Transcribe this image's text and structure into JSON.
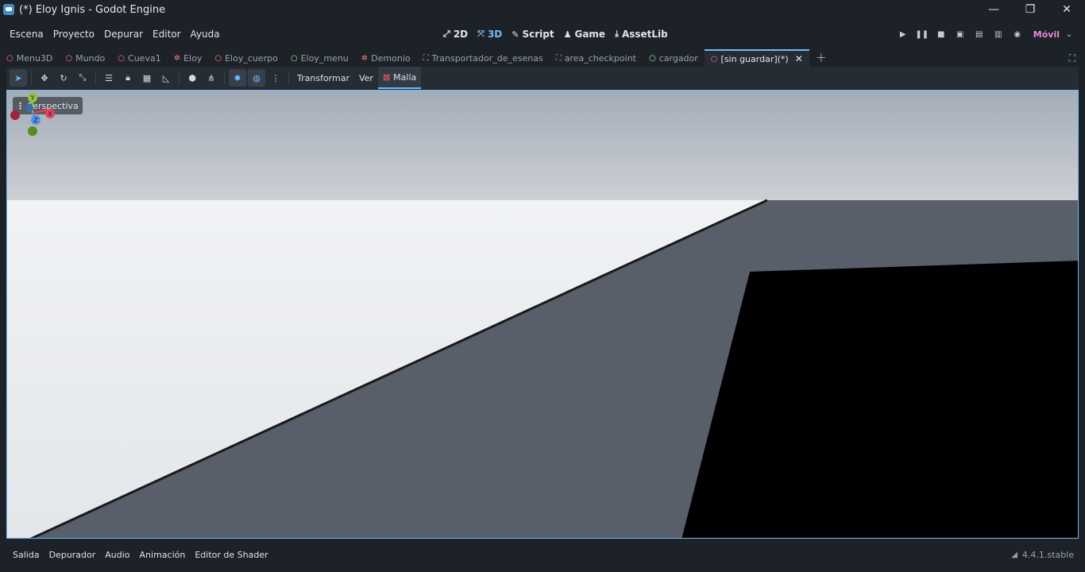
{
  "window": {
    "title": "(*) Eloy Ignis - Godot Engine",
    "controls": {
      "minimize": "—",
      "maximize": "❐",
      "close": "✕"
    }
  },
  "menu": [
    "Escena",
    "Proyecto",
    "Depurar",
    "Editor",
    "Ayuda"
  ],
  "workspaces": [
    {
      "label": "2D",
      "icon": "2d-icon"
    },
    {
      "label": "3D",
      "icon": "3d-icon",
      "active": true
    },
    {
      "label": "Script",
      "icon": "script-icon"
    },
    {
      "label": "Game",
      "icon": "game-icon"
    },
    {
      "label": "AssetLib",
      "icon": "assetlib-icon"
    }
  ],
  "run_bar": {
    "renderer": "Móvil"
  },
  "scene_tabs": [
    {
      "label": "Menu3D",
      "icon": "node3d-icon",
      "color": "#ff7b7b"
    },
    {
      "label": "Mundo",
      "icon": "node3d-icon",
      "color": "#ff7b7b"
    },
    {
      "label": "Cueva1",
      "icon": "node3d-icon",
      "color": "#ff7b7b"
    },
    {
      "label": "Eloy",
      "icon": "character-icon",
      "color": "#ff7b7b"
    },
    {
      "label": "Eloy_cuerpo",
      "icon": "node3d-icon",
      "color": "#ff7b7b"
    },
    {
      "label": "Eloy_menu",
      "icon": "control-icon",
      "color": "#8eef97"
    },
    {
      "label": "Demonio",
      "icon": "character-icon",
      "color": "#ff7b7b"
    },
    {
      "label": "Transportador_de_esenas",
      "icon": "area-icon",
      "color": "#ff7b7b"
    },
    {
      "label": "area_checkpoint",
      "icon": "area-icon",
      "color": "#ff7b7b"
    },
    {
      "label": "cargador",
      "icon": "control-icon",
      "color": "#8eef97"
    },
    {
      "label": "[sin guardar](*)",
      "icon": "node3d-icon",
      "color": "#ff7b7b",
      "active": true
    }
  ],
  "toolbar": {
    "transform_menu": "Transformar",
    "view_menu": "Ver",
    "mesh_menu": "Malla"
  },
  "viewport": {
    "perspective_label": "Perspectiva",
    "gizmo": {
      "x": "X",
      "y": "Y",
      "z": "Z"
    },
    "colors": {
      "sky": "#a9b0ba",
      "floor": "#e9ebee",
      "slope": "#585f6b",
      "shadow": "#000000"
    }
  },
  "bottom_panel": [
    "Salida",
    "Depurador",
    "Audio",
    "Animación",
    "Editor de Shader"
  ],
  "version": "4.4.1.stable",
  "accent_color": "#70bafa"
}
